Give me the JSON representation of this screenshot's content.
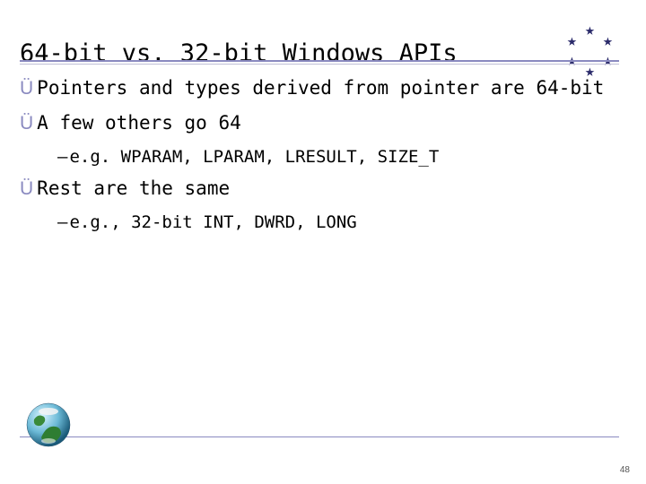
{
  "title": "64-bit vs. 32-bit Windows APIs",
  "bullets": [
    {
      "level": 1,
      "text": "Pointers and types derived from pointer are 64-bit"
    },
    {
      "level": 1,
      "text": "A few others go 64"
    },
    {
      "level": 2,
      "text": "e.g. WPARAM, LPARAM, LRESULT, SIZE_T"
    },
    {
      "level": 1,
      "text": "Rest are the same"
    },
    {
      "level": 2,
      "text": "e.g., 32-bit INT, DWRD, LONG"
    }
  ],
  "icons": {
    "bullet_arrow": "Ü",
    "sub_dash": "–",
    "star": "★",
    "globe": "globe-icon"
  },
  "colors": {
    "rule": "#8a8ac0",
    "star": "#2a2a6a",
    "text": "#000000"
  },
  "page_number": "48"
}
